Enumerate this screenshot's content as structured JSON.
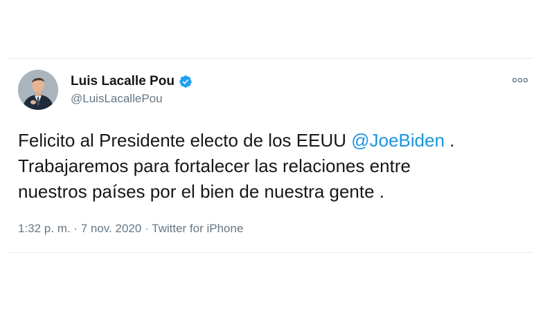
{
  "tweet": {
    "author": {
      "display_name": "Luis Lacalle Pou",
      "handle": "@LuisLacallePou",
      "verified": true,
      "verified_color": "#1da1f2"
    },
    "text": {
      "line1_before": "Felicito al Presidente electo de los EEUU ",
      "mention": "@JoeBiden",
      "line1_after": " .",
      "line2": "Trabajaremos para fortalecer las relaciones entre",
      "line3": "nuestros países por el bien de nuestra gente ."
    },
    "meta": {
      "time": "1:32 p. m.",
      "separator": " · ",
      "date": "7 nov. 2020",
      "source": "Twitter for iPhone"
    },
    "icons": {
      "more": "more-options-icon",
      "verified": "verified-badge-icon",
      "avatar": "profile-photo"
    },
    "colors": {
      "text": "#14171a",
      "secondary": "#657786",
      "link": "#1b95e0"
    }
  }
}
